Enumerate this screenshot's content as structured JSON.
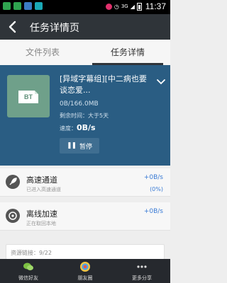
{
  "status_bar": {
    "time": "11:37",
    "network": "3G",
    "colors": {
      "green": "#2fa44f",
      "blue": "#3b7cc4",
      "teal": "#1aa8b6",
      "pink": "#e1306c"
    }
  },
  "header": {
    "title": "任务详情页",
    "back_icon": "back-arrow-icon"
  },
  "tabs": [
    {
      "label": "文件列表",
      "active": false
    },
    {
      "label": "任务详情",
      "active": true
    }
  ],
  "task": {
    "thumbnail_label": "BT",
    "file_name": "[异域字幕组][中二病也要谈恋爱...",
    "size": "0B/166.0MB",
    "remaining": "剩余时间：大于5天",
    "speed_label": "速度：",
    "speed_value": "0B/s",
    "pause_label": "暂停",
    "expand_icon": "chevron-down-icon",
    "hero_color": "#2a5d83"
  },
  "rows": [
    {
      "title": "高速通道",
      "subtitle": "已进入高速通道",
      "speed": "+0B/s",
      "percent": "(0%)",
      "icon": "rocket-icon"
    },
    {
      "title": "离线加速",
      "subtitle": "正在取回本地",
      "speed": "+0B/s",
      "percent": "",
      "icon": "offline-icon"
    }
  ],
  "resources": {
    "label": "资源链接：9/22"
  },
  "share_bar": {
    "items": [
      {
        "label": "微信好友",
        "icon": "wechat-icon"
      },
      {
        "label": "朋友圈",
        "icon": "moments-icon"
      },
      {
        "label": "更多分享",
        "icon": "more-icon"
      }
    ]
  }
}
